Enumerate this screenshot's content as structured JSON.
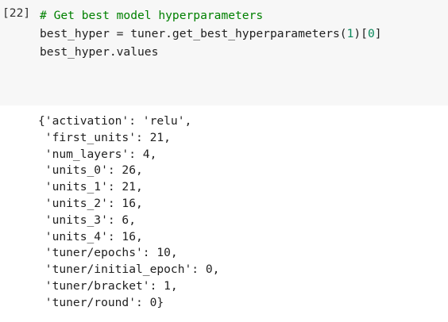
{
  "cell": {
    "prompt": "[22]",
    "code_lines": [
      {
        "comment": "# Get best model hyperparameters"
      },
      {
        "pre": "best_hyper = tuner.get_best_hyperparameters(",
        "num1": "1",
        "mid": ")[",
        "num2": "0",
        "post": "]"
      },
      {
        "text": "best_hyper.values"
      }
    ]
  },
  "output": {
    "lines": [
      "{'activation': 'relu',",
      " 'first_units': 21,",
      " 'num_layers': 4,",
      " 'units_0': 26,",
      " 'units_1': 21,",
      " 'units_2': 16,",
      " 'units_3': 6,",
      " 'units_4': 16,",
      " 'tuner/epochs': 10,",
      " 'tuner/initial_epoch': 0,",
      " 'tuner/bracket': 1,",
      " 'tuner/round': 0}"
    ]
  },
  "colors": {
    "comment": "#008000",
    "number": "#09885a",
    "input_background": "#f7f7f7"
  }
}
